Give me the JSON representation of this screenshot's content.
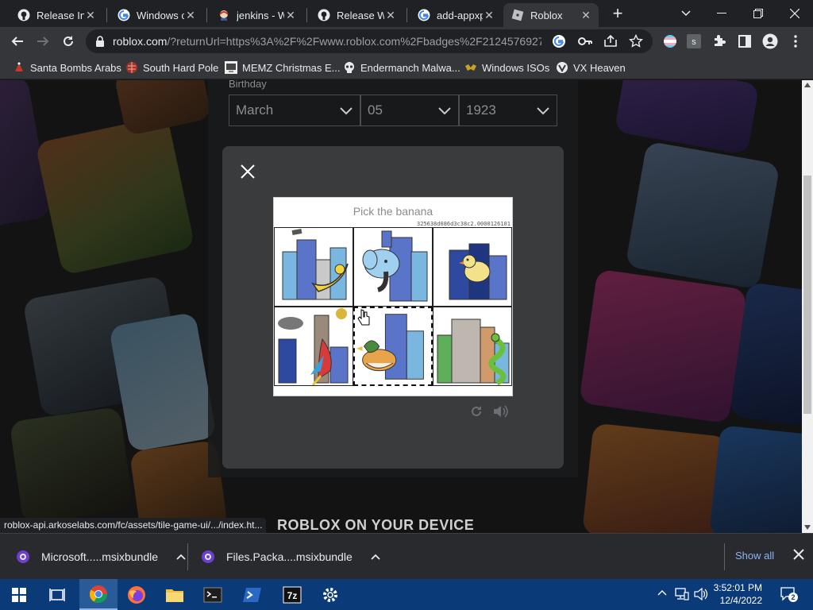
{
  "browser": {
    "tabs": [
      {
        "title": "Release Int",
        "icon": "github-icon"
      },
      {
        "title": "Windows c",
        "icon": "google-icon"
      },
      {
        "title": "jenkins - W",
        "icon": "jenkins-icon"
      },
      {
        "title": "Release Wi",
        "icon": "github-icon"
      },
      {
        "title": "add-appxp",
        "icon": "google-icon"
      },
      {
        "title": "Roblox",
        "icon": "roblox-icon",
        "active": true
      }
    ],
    "new_tab": "+",
    "url_host": "roblox.com",
    "url_rest": "/?returnUrl=https%3A%2F%2Fwww.roblox.com%2Fbadges%2F2124576927...",
    "bookmarks": [
      "Santa Bombs Arabs",
      "South Hard Pole",
      "MEMZ Christmas E...",
      "Endermanch Malwa...",
      "Windows ISOs",
      "VX Heaven"
    ]
  },
  "page": {
    "birthday_label": "Birthday",
    "month": "March",
    "day": "05",
    "year": "1923",
    "captcha": {
      "prompt": "Pick the banana",
      "session_id": "325638d086d3c38c2.0000126101",
      "images": [
        "banana",
        "elephant",
        "bird",
        "parrot",
        "duck",
        "snake"
      ]
    },
    "footer_heading": "ROBLOX ON YOUR DEVICE",
    "status_url": "roblox-api.arkoselabs.com/fc/assets/tile-game-ui/.../index.ht..."
  },
  "downloads": {
    "items": [
      "Microsoft.....msixbundle",
      "Files.Packa....msixbundle"
    ],
    "show_all": "Show all"
  },
  "taskbar": {
    "time": "3:52:01 PM",
    "date": "12/4/2022",
    "notification_count": "2"
  },
  "colors": {
    "chrome_dark": "#202124",
    "chrome_toolbar": "#35363a",
    "modal_bg": "#393b3d",
    "taskbar": "#0b3a78",
    "link": "#8ab4f8"
  }
}
